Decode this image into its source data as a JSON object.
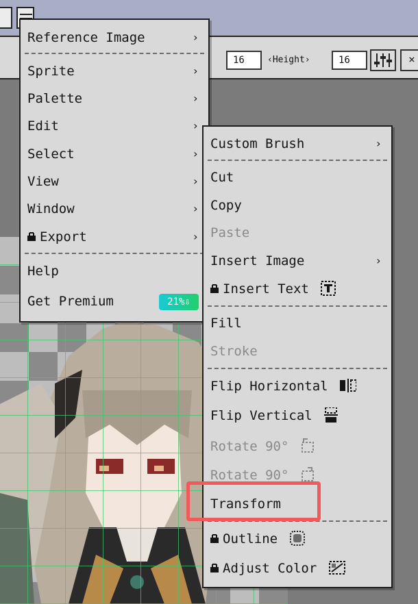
{
  "toolbar": {
    "width_value": "16",
    "height_label": "‹Height›",
    "height_value": "16",
    "close_glyph": "×"
  },
  "main_menu": {
    "items": [
      {
        "label": "Reference Image",
        "arrow": "›"
      },
      {
        "label": "Sprite",
        "arrow": "›"
      },
      {
        "label": "Palette",
        "arrow": "›"
      },
      {
        "label": "Edit",
        "arrow": "›"
      },
      {
        "label": "Select",
        "arrow": "›"
      },
      {
        "label": "View",
        "arrow": "›"
      },
      {
        "label": "Window",
        "arrow": "›"
      },
      {
        "label": "Export",
        "arrow": "›",
        "locked": true
      },
      {
        "label": "Help"
      },
      {
        "label": "Get Premium",
        "badge": "21%⇩"
      }
    ]
  },
  "edit_menu": {
    "items": [
      {
        "label": "Custom Brush",
        "arrow": "›"
      },
      {
        "label": "Cut"
      },
      {
        "label": "Copy"
      },
      {
        "label": "Paste",
        "disabled": true
      },
      {
        "label": "Insert Image",
        "arrow": "›"
      },
      {
        "label": "Insert Text",
        "locked": true,
        "icon": "text-tool-icon"
      },
      {
        "label": "Fill"
      },
      {
        "label": "Stroke",
        "disabled": true
      },
      {
        "label": "Flip Horizontal",
        "icon": "flip-horizontal-icon"
      },
      {
        "label": "Flip Vertical",
        "icon": "flip-vertical-icon"
      },
      {
        "label": "Rotate 90°",
        "disabled": true,
        "icon": "rotate-ccw-icon"
      },
      {
        "label": "Rotate 90°",
        "disabled": true,
        "icon": "rotate-cw-icon"
      },
      {
        "label": "Transform",
        "highlighted": true
      },
      {
        "label": "Outline",
        "locked": true,
        "icon": "outline-icon"
      },
      {
        "label": "Adjust Color",
        "locked": true,
        "icon": "adjust-color-icon"
      }
    ]
  },
  "colors": {
    "menu_bg": "#d9d9d9",
    "disabled_text": "#8a8a8a",
    "highlight": "#f15a5a",
    "badge_start": "#19c9d6",
    "badge_end": "#22d06a",
    "grid": "#3cc86e"
  }
}
